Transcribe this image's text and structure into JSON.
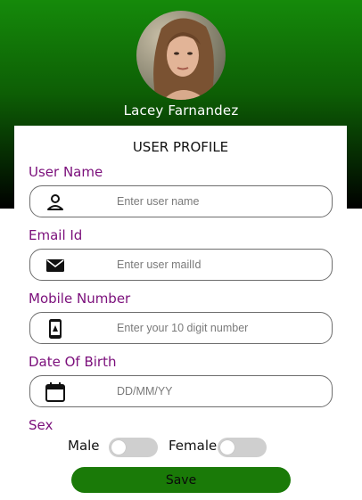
{
  "profile": {
    "name": "Lacey Farnandez"
  },
  "card": {
    "title": "USER PROFILE"
  },
  "fields": [
    {
      "label": "User Name",
      "placeholder": "Enter user name",
      "icon": "person-icon"
    },
    {
      "label": "Email Id",
      "placeholder": "Enter user mailId",
      "icon": "mail-icon"
    },
    {
      "label": "Mobile Number",
      "placeholder": "Enter your 10 digit number",
      "icon": "mobile-icon"
    },
    {
      "label": "Date Of Birth",
      "placeholder": "DD/MM/YY",
      "icon": "calendar-icon"
    }
  ],
  "sex": {
    "label": "Sex",
    "options": [
      {
        "label": "Male",
        "checked": false
      },
      {
        "label": "Female",
        "checked": false
      }
    ]
  },
  "save_label": "Save",
  "colors": {
    "header_top": "#158a0a",
    "header_bottom": "#000000",
    "label": "#7b0f7b",
    "button": "#1a7a08",
    "toggle_off": "#cfcfcf"
  }
}
